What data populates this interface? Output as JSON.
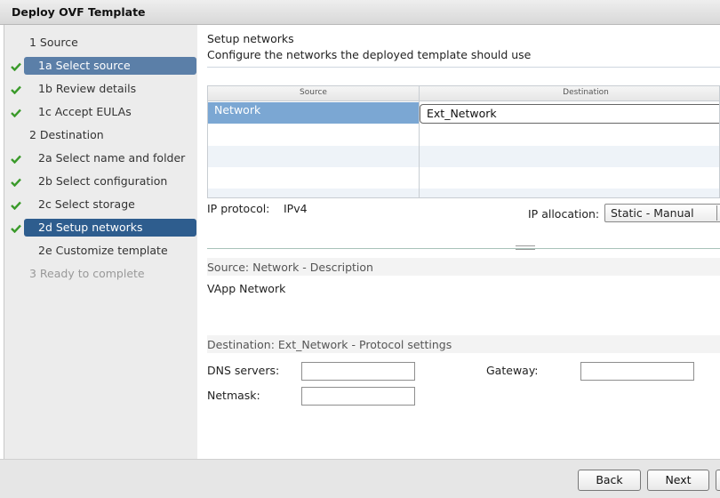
{
  "window": {
    "title": "Deploy OVF Template"
  },
  "steps": [
    {
      "label": "1  Source"
    },
    {
      "label": "1a  Select source"
    },
    {
      "label": "1b  Review details"
    },
    {
      "label": "1c  Accept EULAs"
    },
    {
      "label": "2  Destination"
    },
    {
      "label": "2a  Select name and folder"
    },
    {
      "label": "2b  Select configuration"
    },
    {
      "label": "2c  Select storage"
    },
    {
      "label": "2d  Setup networks"
    },
    {
      "label": "2e  Customize template"
    },
    {
      "label": "3  Ready to complete"
    }
  ],
  "main": {
    "heading": "Setup networks",
    "subheading": "Configure the networks the deployed template should use",
    "table": {
      "col_source": "Source",
      "col_destination": "Destination",
      "rows": [
        {
          "source": "Network",
          "destination": "Ext_Network"
        }
      ]
    },
    "ip_protocol_label": "IP protocol:",
    "ip_protocol_value": "IPv4",
    "ip_allocation_label": "IP allocation:",
    "ip_allocation_value": "Static - Manual",
    "source_section_title": "Source: Network - Description",
    "source_description": "VApp Network",
    "dest_section_title": "Destination: Ext_Network - Protocol settings",
    "dns_label": "DNS servers:",
    "gateway_label": "Gateway:",
    "netmask_label": "Netmask:",
    "dns_value": "",
    "gateway_value": "",
    "netmask_value": ""
  },
  "footer": {
    "back_label": "Back",
    "next_label": "Next"
  },
  "colors": {
    "selected_step": "#5b7fa8",
    "current_step": "#2e5d8e",
    "check": "#3a9a2a",
    "table_selected": "#7ba7d3"
  }
}
